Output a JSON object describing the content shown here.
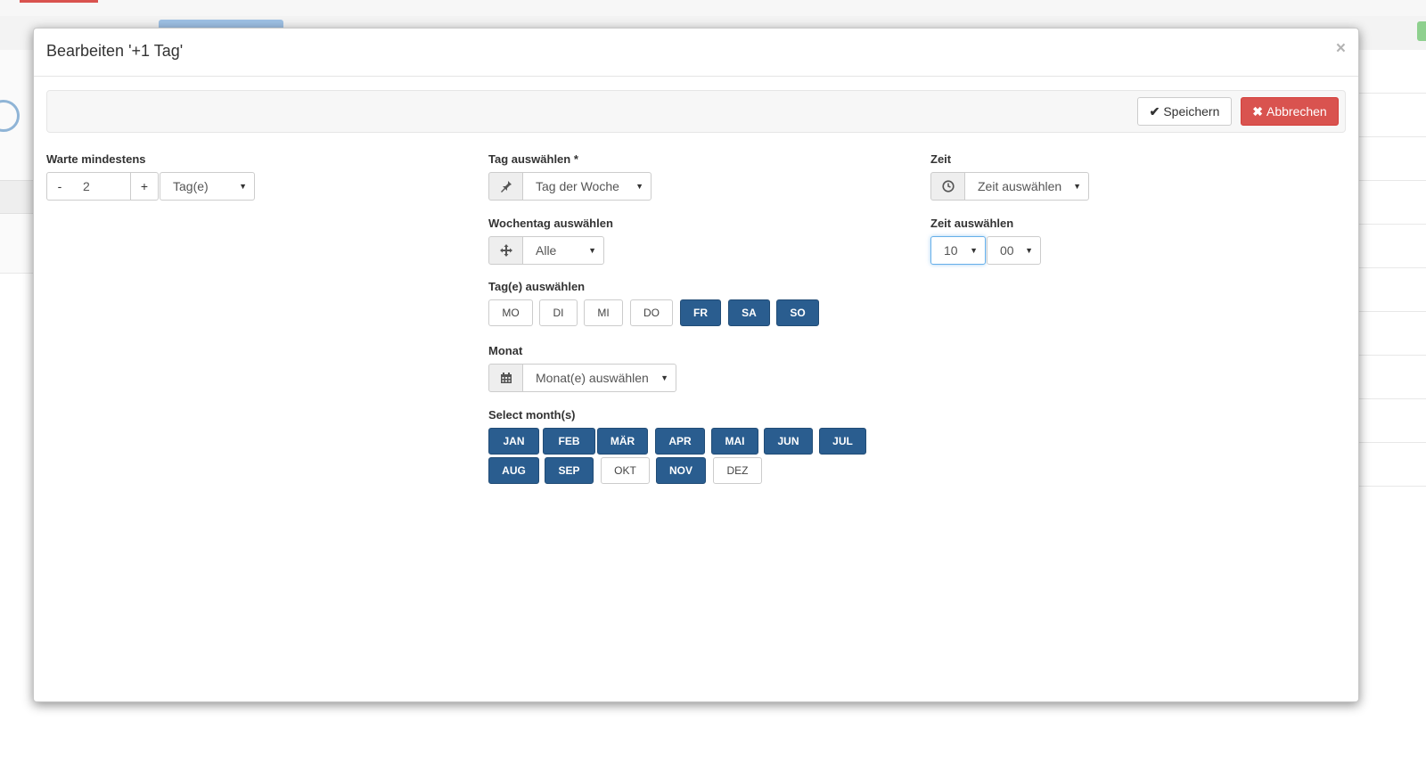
{
  "modal": {
    "title": "Bearbeiten '+1 Tag'",
    "close_symbol": "×",
    "save_label": "Speichern",
    "cancel_label": "Abbrechen",
    "save_icon": "check-icon",
    "cancel_icon": "x-icon",
    "accent_color": "#2a5d8f",
    "cancel_color": "#d9534f"
  },
  "wait": {
    "label": "Warte mindestens",
    "minus": "-",
    "value": "2",
    "plus": "+",
    "unit": "Tag(e)"
  },
  "day_select": {
    "label": "Tag auswählen",
    "required_mark": "*",
    "icon": "pin-icon",
    "value": "Tag der Woche"
  },
  "weekday": {
    "label": "Wochentag auswählen",
    "icon": "move-icon",
    "value": "Alle"
  },
  "days": {
    "label": "Tag(e) auswählen",
    "items": [
      {
        "label": "MO",
        "selected": false
      },
      {
        "label": "DI",
        "selected": false
      },
      {
        "label": "MI",
        "selected": false
      },
      {
        "label": "DO",
        "selected": false
      },
      {
        "label": "FR",
        "selected": true
      },
      {
        "label": "SA",
        "selected": true
      },
      {
        "label": "SO",
        "selected": true
      }
    ]
  },
  "month": {
    "label": "Monat",
    "icon": "calendar-icon",
    "value": "Monat(e) auswählen"
  },
  "months": {
    "label": "Select month(s)",
    "items": [
      {
        "label": "JAN",
        "selected": true
      },
      {
        "label": "FEB",
        "selected": true
      },
      {
        "label": "MÄR",
        "selected": true
      },
      {
        "label": "APR",
        "selected": true
      },
      {
        "label": "MAI",
        "selected": true
      },
      {
        "label": "JUN",
        "selected": true
      },
      {
        "label": "JUL",
        "selected": true
      },
      {
        "label": "AUG",
        "selected": true
      },
      {
        "label": "SEP",
        "selected": true
      },
      {
        "label": "OKT",
        "selected": false
      },
      {
        "label": "NOV",
        "selected": true
      },
      {
        "label": "DEZ",
        "selected": false
      }
    ]
  },
  "time": {
    "label": "Zeit",
    "icon": "clock-icon",
    "value": "Zeit auswählen",
    "select_label": "Zeit auswählen",
    "hour": "10",
    "minute": "00"
  }
}
